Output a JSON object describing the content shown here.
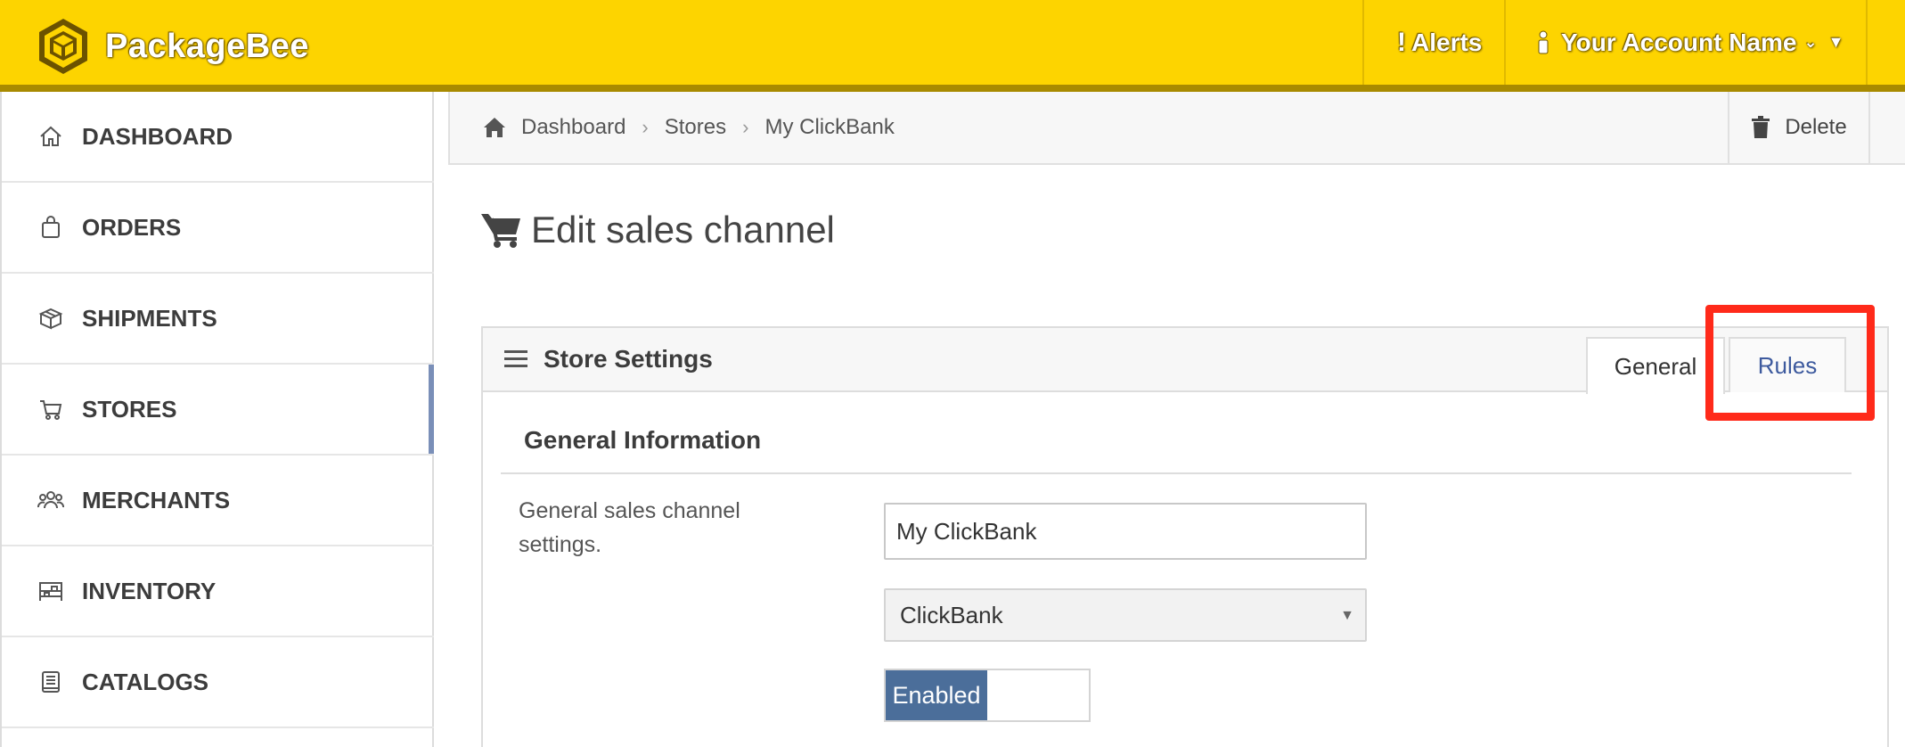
{
  "app": {
    "name": "PackageBee"
  },
  "topbar": {
    "alerts_label": "Alerts",
    "account_label": "Your Account Name"
  },
  "sidebar": {
    "items": [
      {
        "label": "DASHBOARD",
        "icon": "home-icon"
      },
      {
        "label": "ORDERS",
        "icon": "shopping-bag-icon"
      },
      {
        "label": "SHIPMENTS",
        "icon": "box-icon"
      },
      {
        "label": "STORES",
        "icon": "cart-icon",
        "active": true
      },
      {
        "label": "MERCHANTS",
        "icon": "users-icon"
      },
      {
        "label": "INVENTORY",
        "icon": "warehouse-icon"
      },
      {
        "label": "CATALOGS",
        "icon": "book-icon"
      }
    ]
  },
  "breadcrumb": {
    "items": [
      "Dashboard",
      "Stores",
      "My ClickBank"
    ],
    "delete_label": "Delete"
  },
  "page": {
    "title": "Edit sales channel"
  },
  "panel": {
    "title": "Store Settings",
    "tabs": [
      {
        "label": "General",
        "active": true
      },
      {
        "label": "Rules",
        "active": false,
        "highlighted": true
      }
    ],
    "section_title": "General Information",
    "description": "General sales channel settings.",
    "name_value": "My ClickBank",
    "channel_type": "ClickBank",
    "status_label": "Enabled"
  },
  "colors": {
    "topbar": "#fdd400",
    "accent_blue": "#4b6e9a",
    "tab_link": "#3d5a9e",
    "highlight": "#ff2a1a"
  }
}
